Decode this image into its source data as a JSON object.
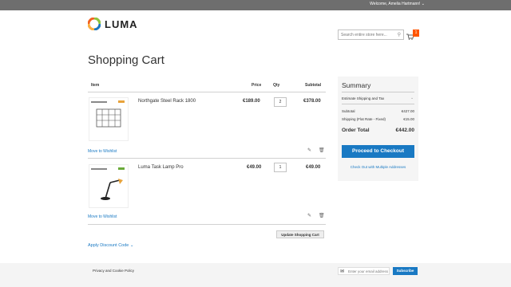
{
  "topbar": {
    "welcome": "Welcome, Amelia Hartmann! ⌄"
  },
  "header": {
    "logo_text": "LUMA",
    "search_placeholder": "Search entire store here...",
    "cart_count": "1"
  },
  "page_title": "Shopping Cart",
  "cart_table": {
    "headers": {
      "item": "Item",
      "price": "Price",
      "qty": "Qty",
      "subtotal": "Subtotal"
    },
    "rows": [
      {
        "name": "Northgate Steel Rack 1800",
        "price": "€189.00",
        "qty": "2",
        "subtotal": "€378.00",
        "wishlist": "Move to Wishlist"
      },
      {
        "name": "Luma Task Lamp Pro",
        "price": "€49.00",
        "qty": "1",
        "subtotal": "€49.00",
        "wishlist": "Move to Wishlist"
      }
    ],
    "update_button": "Update Shopping Cart",
    "discount_link": "Apply Discount Code  ⌄"
  },
  "summary": {
    "title": "Summary",
    "estimate_label": "Estimate Shipping and Tax",
    "subtotal_label": "Subtotal",
    "subtotal_value": "€427.00",
    "shipping_label": "Shipping (Flat Rate - Fixed)",
    "shipping_value": "€15.00",
    "total_label": "Order Total",
    "total_value": "€442.00",
    "checkout_button": "Proceed to Checkout",
    "multi_address_link": "Check Out with Multiple Addresses"
  },
  "footer": {
    "privacy": "Privacy and Cookie Policy",
    "newsletter_placeholder": "Enter your email address",
    "subscribe_button": "Subscribe"
  },
  "colors": {
    "accent": "#1979c3",
    "cart_badge": "#ff5501",
    "topbar": "#6e6e6e"
  }
}
